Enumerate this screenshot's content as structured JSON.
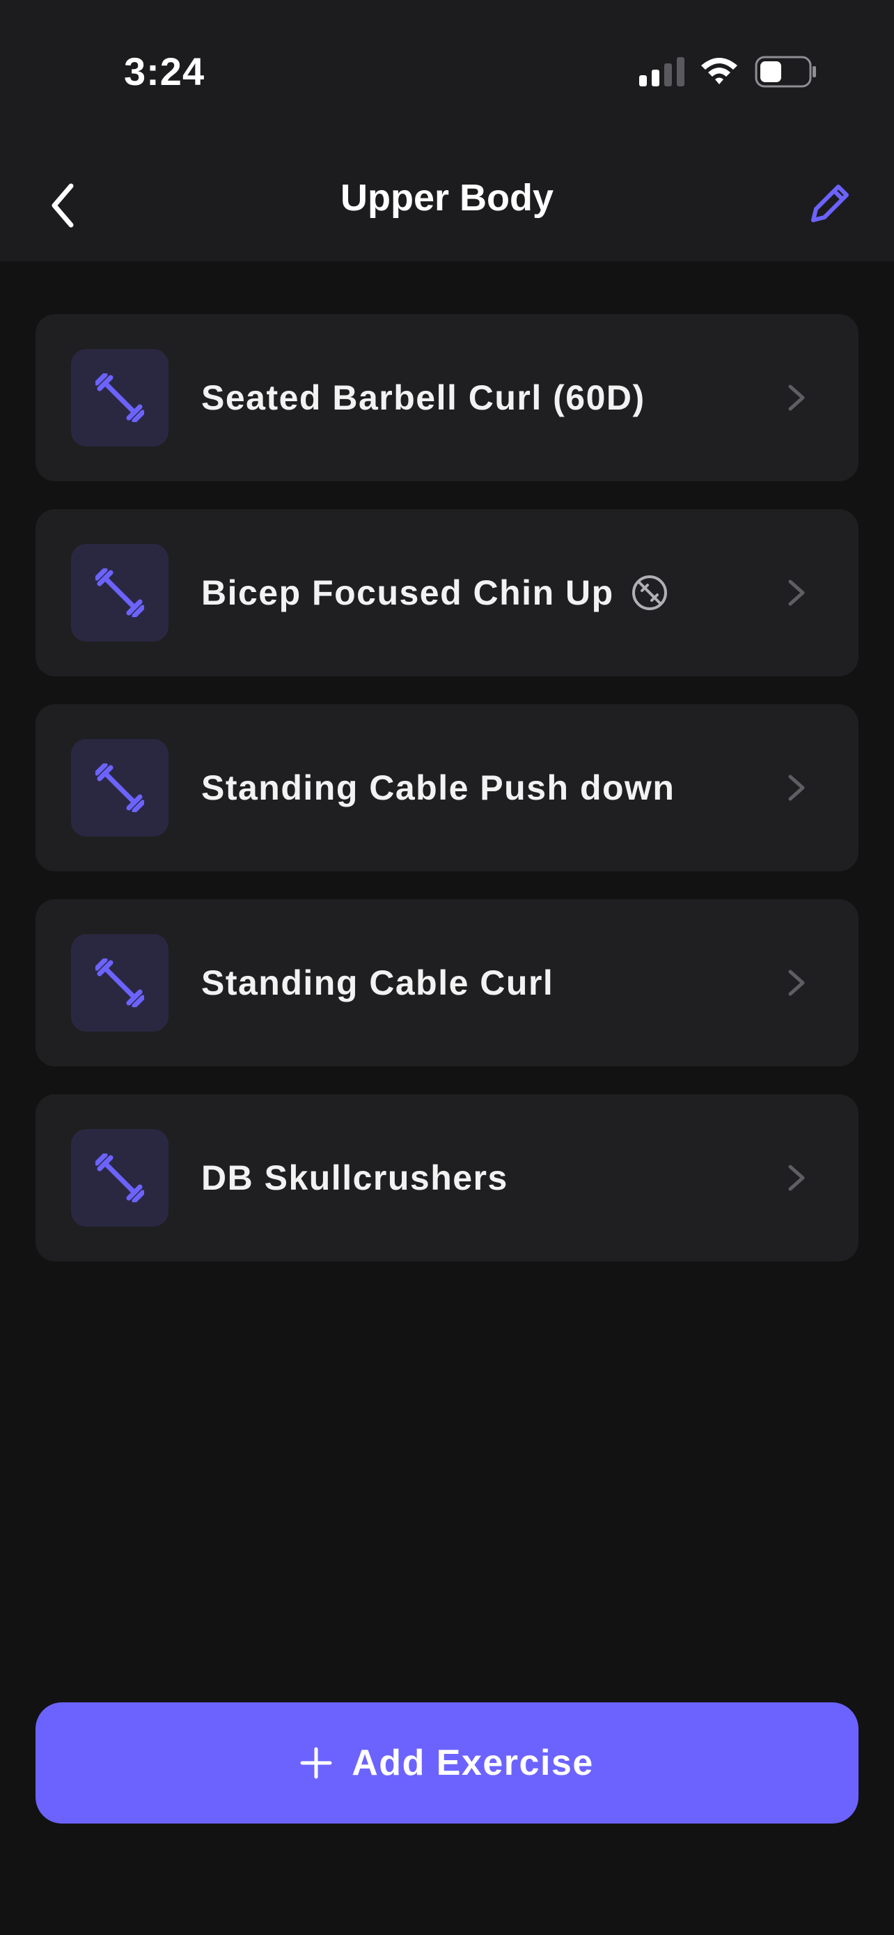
{
  "status_bar": {
    "time": "3:24"
  },
  "nav": {
    "title": "Upper Body",
    "back_icon": "chevron-left-icon",
    "edit_icon": "pencil-icon"
  },
  "exercises": [
    {
      "name": "Seated Barbell Curl (60D)",
      "icon": "dumbbell-icon"
    },
    {
      "name": "Bicep Focused Chin Up",
      "icon": "dumbbell-icon",
      "badge_icon": "no-equipment-icon"
    },
    {
      "name": "Standing Cable Push down",
      "icon": "dumbbell-icon"
    },
    {
      "name": "Standing Cable Curl",
      "icon": "dumbbell-icon"
    },
    {
      "name": "DB Skullcrushers",
      "icon": "dumbbell-icon"
    }
  ],
  "add_button": {
    "label": "Add Exercise",
    "icon": "plus-icon"
  },
  "colors": {
    "accent": "#6c63ff",
    "background": "#121212",
    "header": "#1c1c1e",
    "card": "#1f1f21",
    "thumb": "#2a2841"
  }
}
